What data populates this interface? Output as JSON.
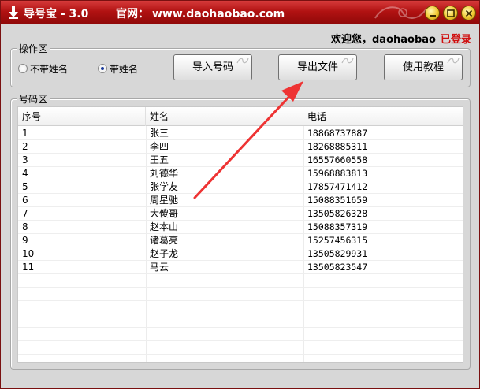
{
  "window": {
    "title": "导号宝 - 3.0",
    "site_prefix": "官网：",
    "site_url": "www.daohaobao.com",
    "accent_color": "#b11212"
  },
  "header": {
    "welcome": "欢迎您，daohaobao",
    "status": "已登录",
    "status_color": "#d01010"
  },
  "operations": {
    "legend": "操作区",
    "radio_options": [
      {
        "label": "不带姓名",
        "checked": false
      },
      {
        "label": "带姓名",
        "checked": true
      }
    ],
    "buttons": {
      "import": "导入号码",
      "export": "导出文件",
      "tutorial": "使用教程"
    }
  },
  "number_list": {
    "legend": "号码区",
    "columns": [
      "序号",
      "姓名",
      "电话"
    ],
    "rows": [
      [
        "1",
        "张三",
        "18868737887"
      ],
      [
        "2",
        "李四",
        "18268885311"
      ],
      [
        "3",
        "王五",
        "16557660558"
      ],
      [
        "4",
        "刘德华",
        "15968883813"
      ],
      [
        "5",
        "张学友",
        "17857471412"
      ],
      [
        "6",
        "周星驰",
        "15088351659"
      ],
      [
        "7",
        "大傻哥",
        "13505826328"
      ],
      [
        "8",
        "赵本山",
        "15088357319"
      ],
      [
        "9",
        "诸葛亮",
        "15257456315"
      ],
      [
        "10",
        "赵子龙",
        "13505829931"
      ],
      [
        "11",
        "马云",
        "13505823547"
      ]
    ]
  },
  "annotation": {
    "arrow_color": "#ee3333",
    "points_to": "export-button"
  }
}
